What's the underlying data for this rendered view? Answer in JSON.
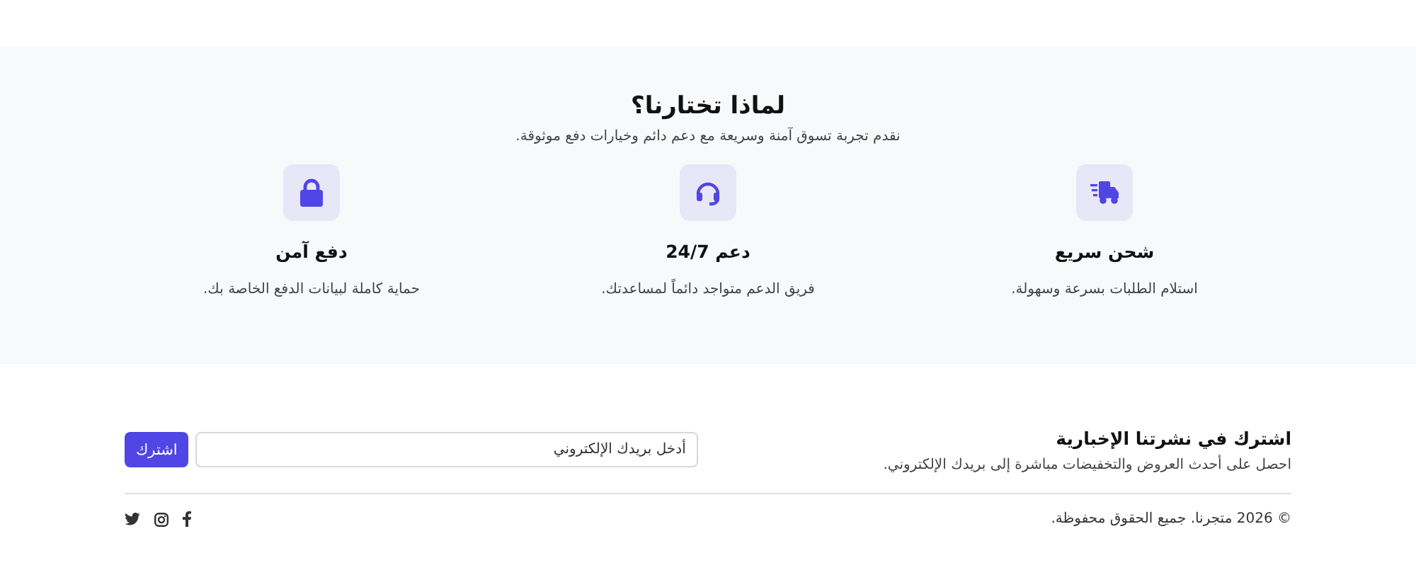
{
  "why_us": {
    "title": "لماذا تختارنا؟",
    "subtitle": "نقدم تجربة تسوق آمنة وسريعة مع دعم دائم وخيارات دفع موثوقة.",
    "features": [
      {
        "kind": "truck",
        "title": "شحن سريع",
        "text": "استلام الطلبات بسرعة وسهولة."
      },
      {
        "kind": "headset",
        "title": "دعم 24/7",
        "text": "فريق الدعم متواجد دائماً لمساعدتك."
      },
      {
        "kind": "lock",
        "title": "دفع آمن",
        "text": "حماية كاملة لبيانات الدفع الخاصة بك."
      }
    ]
  },
  "newsletter": {
    "title": "اشترك في نشرتنا الإخبارية",
    "text": "احصل على أحدث العروض والتخفيضات مباشرة إلى بريدك الإلكتروني.",
    "placeholder": "أدخل بريدك الإلكتروني",
    "button": "اشترك"
  },
  "footer": {
    "copyright": "© 2026 متجرنا. جميع الحقوق محفوظة.",
    "social": [
      {
        "kind": "facebook"
      },
      {
        "kind": "instagram"
      },
      {
        "kind": "twitter"
      }
    ]
  }
}
